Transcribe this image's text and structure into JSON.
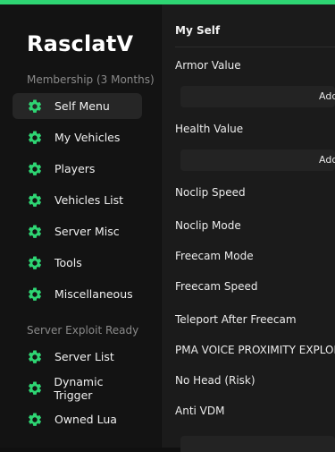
{
  "brand": "RasclatV",
  "accent_color": "#2ed573",
  "sections": {
    "membership": "Membership (3 Months)",
    "exploit": "Server Exploit Ready"
  },
  "nav": [
    {
      "label": "Self Menu",
      "icon": "gear-icon",
      "active": true
    },
    {
      "label": "My Vehicles",
      "icon": "gear-icon"
    },
    {
      "label": "Players",
      "icon": "gear-icon"
    },
    {
      "label": "Vehicles List",
      "icon": "gear-icon"
    },
    {
      "label": "Server Misc",
      "icon": "gear-icon"
    },
    {
      "label": "Tools",
      "icon": "gear-icon"
    },
    {
      "label": "Miscellaneous",
      "icon": "gear-icon"
    },
    {
      "label": "Server List",
      "icon": "gear-icon"
    },
    {
      "label": "Dynamic Trigger",
      "icon": "gear-icon"
    },
    {
      "label": "Owned Lua",
      "icon": "gear-icon"
    }
  ],
  "main": {
    "title": "My Self",
    "armor_label": "Armor Value",
    "armor_button": "Add",
    "health_label": "Health Value",
    "health_button": "Add",
    "noclip_speed": "Noclip Speed",
    "noclip_mode": "Noclip Mode",
    "freecam_mode": "Freecam Mode",
    "freecam_speed": "Freecam Speed",
    "teleport_after_freecam": "Teleport After Freecam",
    "pma_voice": "PMA VOICE PROXIMITY EXPLOIT",
    "no_head": "No Head (Risk)",
    "anti_vdm": "Anti VDM"
  }
}
